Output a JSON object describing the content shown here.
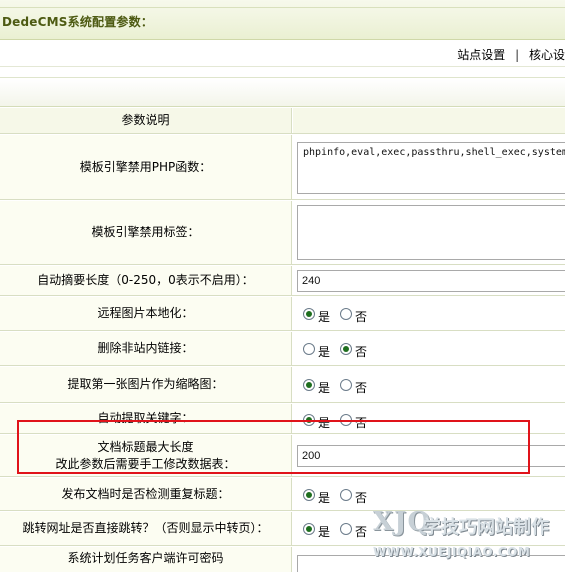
{
  "title": "DedeCMS系统配置参数：",
  "nav": {
    "site_settings": "站点设置",
    "separator": "|",
    "core_settings": "核心设"
  },
  "table": {
    "header": "参数说明",
    "rows": [
      {
        "label": "模板引擎禁用PHP函数：",
        "type": "textarea",
        "value": "phpinfo,eval,exec,passthru,shell_exec,system"
      },
      {
        "label": "模板引擎禁用标签：",
        "type": "textarea",
        "value": ""
      },
      {
        "label": "自动摘要长度（0-250，0表示不启用）：",
        "type": "input",
        "value": "240"
      },
      {
        "label": "远程图片本地化：",
        "type": "radio",
        "yes": "是",
        "no": "否",
        "selected": "yes"
      },
      {
        "label": "删除非站内链接：",
        "type": "radio",
        "yes": "是",
        "no": "否",
        "selected": "no"
      },
      {
        "label": "提取第一张图片作为缩略图：",
        "type": "radio",
        "yes": "是",
        "no": "否",
        "selected": "yes"
      },
      {
        "label": "自动提取关键字：",
        "type": "radio",
        "yes": "是",
        "no": "否",
        "selected": "yes"
      },
      {
        "label_line1": "文档标题最大长度",
        "label_line2": "改此参数后需要手工修改数据表：",
        "type": "input",
        "value": "200"
      },
      {
        "label": "发布文档时是否检测重复标题：",
        "type": "radio",
        "yes": "是",
        "no": "否",
        "selected": "yes"
      },
      {
        "label": "跳转网址是否直接跳转？（否则显示中转页）：",
        "type": "radio",
        "yes": "是",
        "no": "否",
        "selected": "yes"
      },
      {
        "label": "系统计划任务客户端许可密码",
        "type": "input",
        "value": ""
      }
    ]
  },
  "watermark": {
    "logo": "XJQ",
    "name": "学技巧网站制作",
    "url": "WWW.XUEJIQIAO.COM"
  },
  "colors": {
    "title": "#4d5a12",
    "label_bg": "#fcfdf2",
    "border": "#d8dec3",
    "highlight": "#e0131a",
    "radio_on": "#1e6e1e"
  }
}
